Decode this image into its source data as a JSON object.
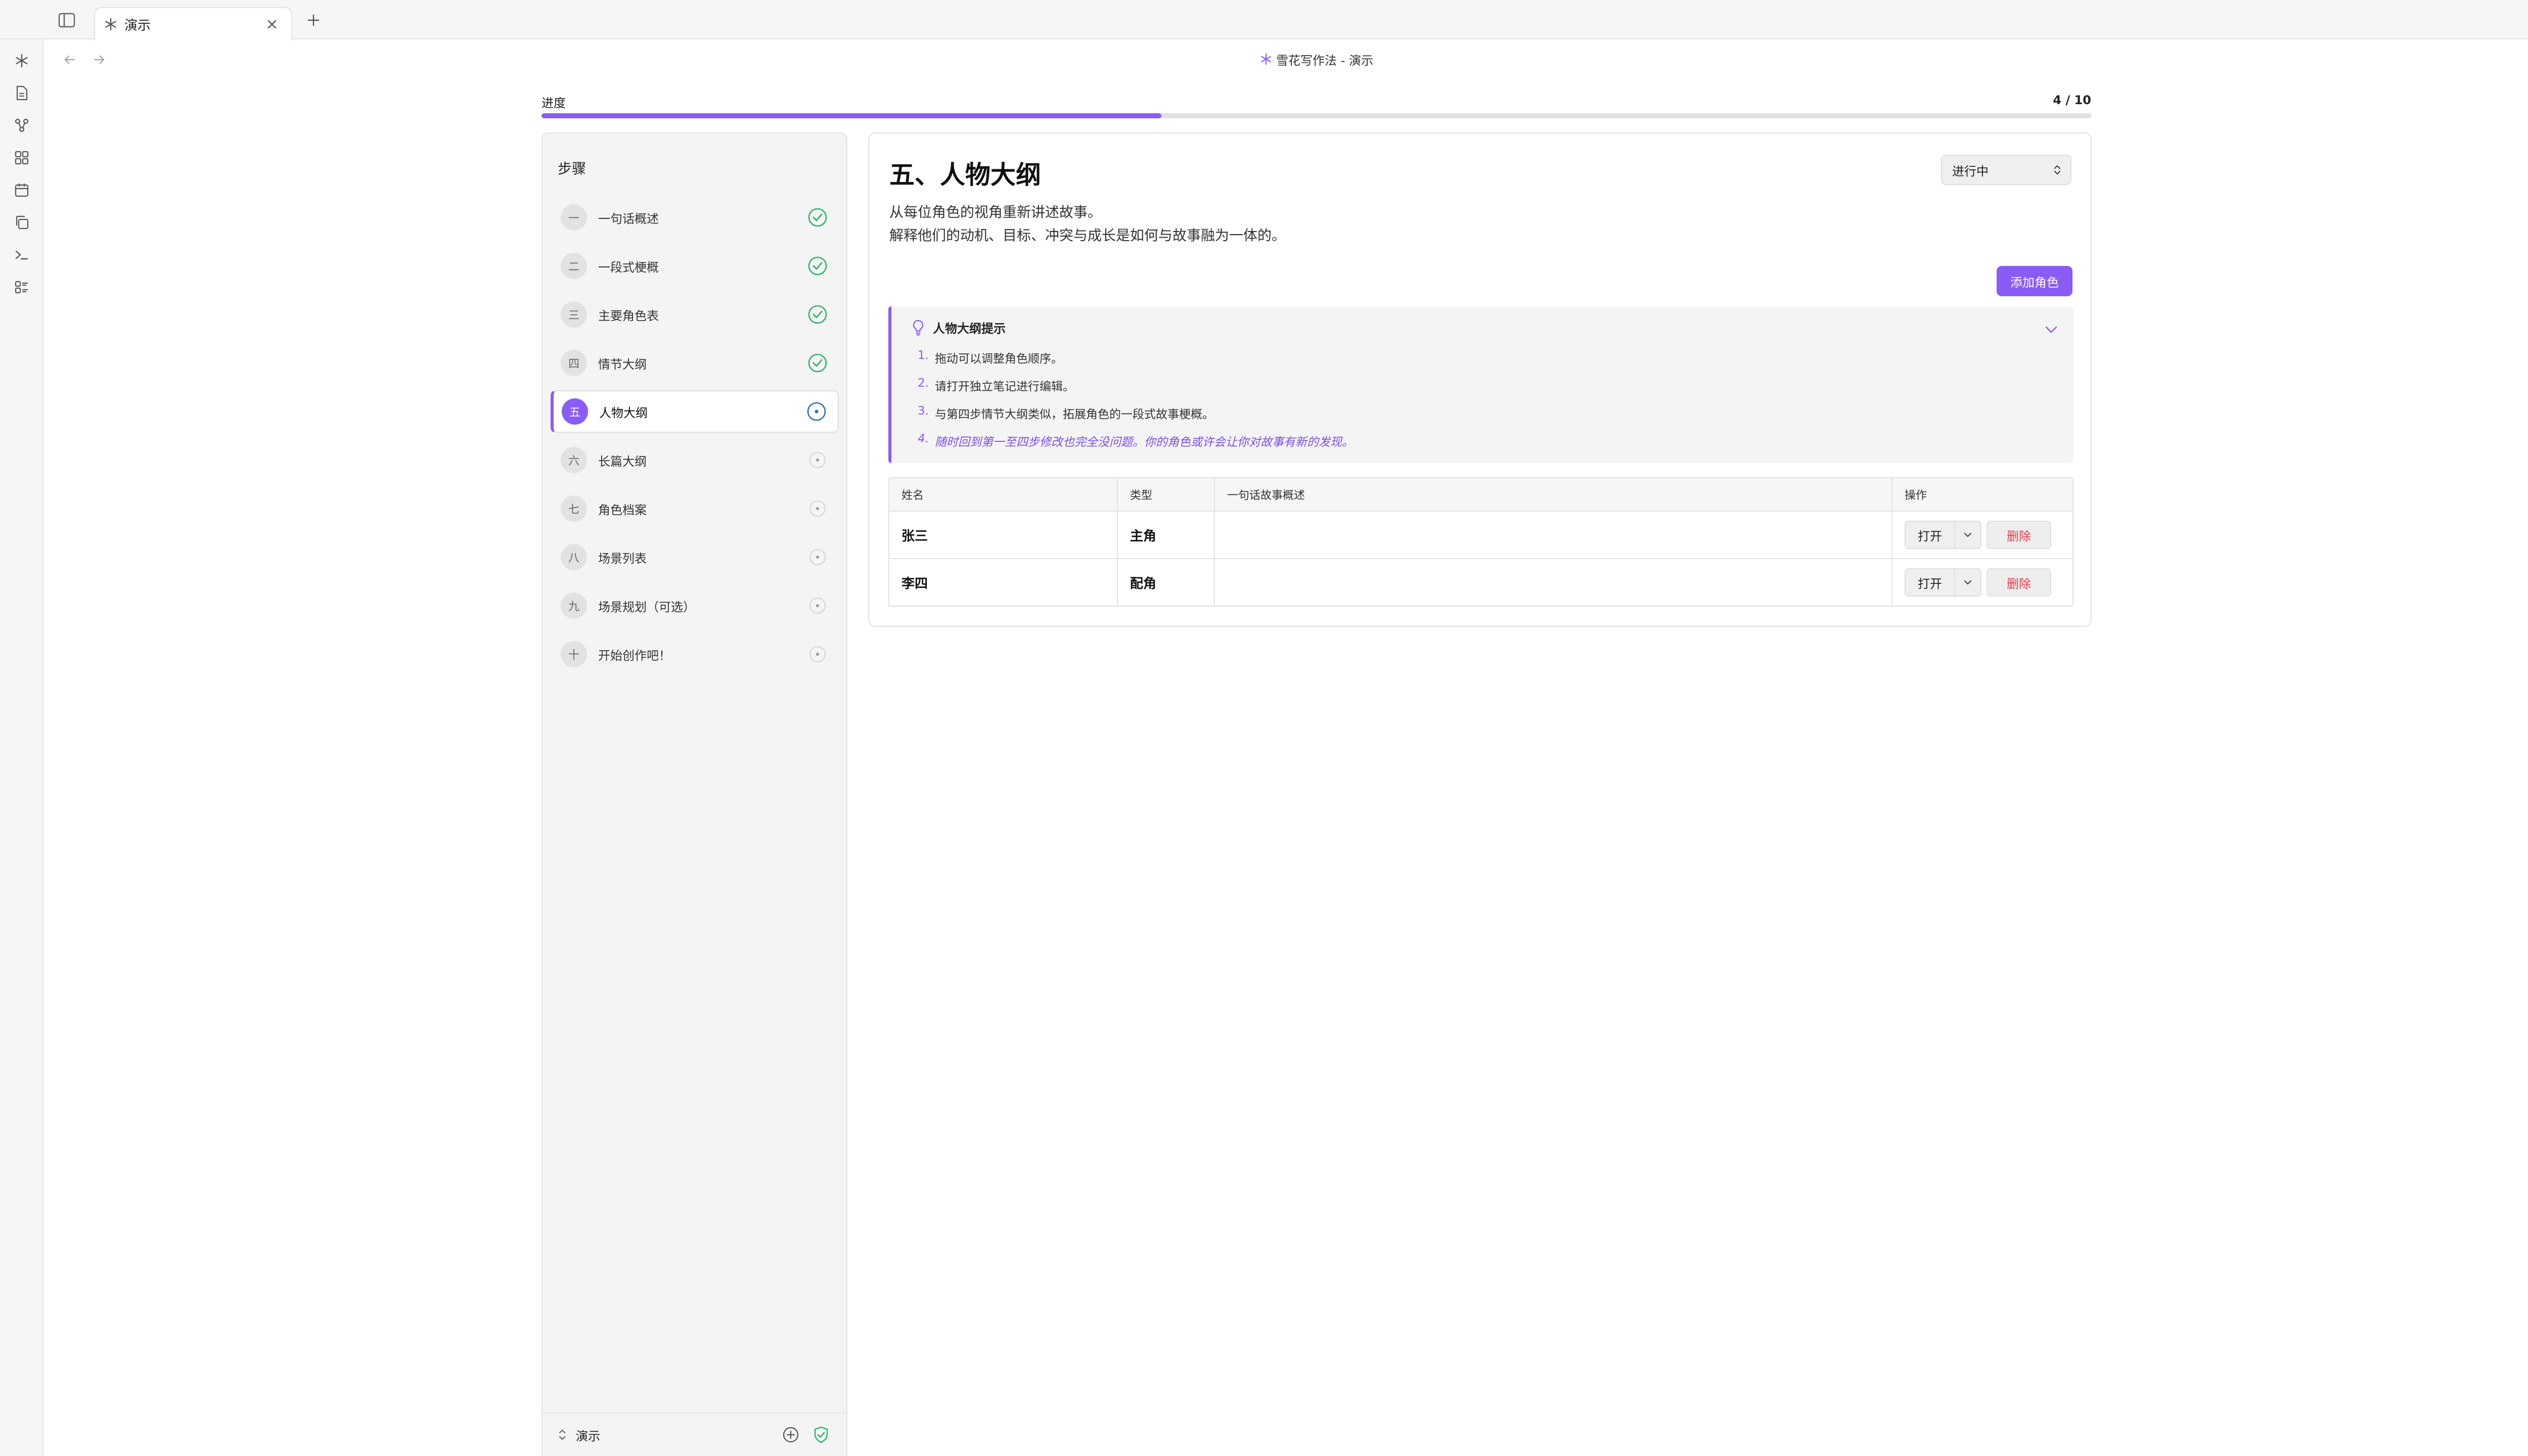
{
  "tabbar": {
    "tab_title": "演示"
  },
  "view": {
    "title": "雪花写作法 - 演示"
  },
  "progress": {
    "label": "进度",
    "count": "4 / 10",
    "fraction": 0.4
  },
  "steps": {
    "heading": "步骤",
    "items": [
      {
        "num": "一",
        "label": "一句话概述",
        "status": "done"
      },
      {
        "num": "二",
        "label": "一段式梗概",
        "status": "done"
      },
      {
        "num": "三",
        "label": "主要角色表",
        "status": "done"
      },
      {
        "num": "四",
        "label": "情节大纲",
        "status": "done"
      },
      {
        "num": "五",
        "label": "人物大纲",
        "status": "active"
      },
      {
        "num": "六",
        "label": "长篇大纲",
        "status": "pending"
      },
      {
        "num": "七",
        "label": "角色档案",
        "status": "pending"
      },
      {
        "num": "八",
        "label": "场景列表",
        "status": "pending"
      },
      {
        "num": "九",
        "label": "场景规划（可选）",
        "status": "pending"
      },
      {
        "num": "十",
        "label": "开始创作吧！",
        "status": "pending"
      }
    ],
    "footer_label": "演示"
  },
  "main": {
    "title": "五、人物大纲",
    "status_value": "进行中",
    "description": [
      "从每位角色的视角重新讲述故事。",
      "解释他们的动机、目标、冲突与成长是如何与故事融为一体的。"
    ],
    "add_button": "添加角色",
    "callout": {
      "title": "人物大纲提示",
      "tips": [
        {
          "num": "1.",
          "text": "拖动可以调整角色顺序。"
        },
        {
          "num": "2.",
          "text": "请打开独立笔记进行编辑。"
        },
        {
          "num": "3.",
          "text": "与第四步情节大纲类似，拓展角色的一段式故事梗概。"
        },
        {
          "num": "4.",
          "text": "随时回到第一至四步修改也完全没问题。你的角色或许会让你对故事有新的发现。"
        }
      ]
    },
    "table": {
      "headers": [
        "姓名",
        "类型",
        "一句话故事概述",
        "操作"
      ],
      "rows": [
        {
          "name": "张三",
          "type": "主角",
          "summary": ""
        },
        {
          "name": "李四",
          "type": "配角",
          "summary": ""
        }
      ],
      "open_label": "打开",
      "delete_label": "删除"
    }
  },
  "colors": {
    "accent": "#8a5cf6",
    "done_green": "#2fb36b",
    "danger": "#e0404a"
  },
  "icons": {
    "ribbon": [
      "snowflake-icon",
      "file-icon",
      "graph-icon",
      "grid-icon",
      "calendar-icon",
      "copy-icon",
      "terminal-icon",
      "list-icon"
    ]
  }
}
